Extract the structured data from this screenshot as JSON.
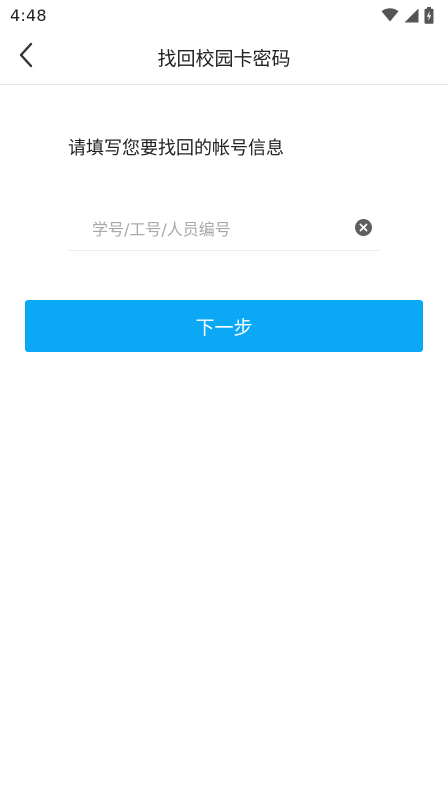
{
  "status_bar": {
    "time": "4:48",
    "icons": [
      "wifi-icon",
      "cellular-signal-icon",
      "battery-charging-icon"
    ]
  },
  "header": {
    "back_icon": "chevron-left-icon",
    "title": "找回校园卡密码"
  },
  "form": {
    "prompt": "请填写您要找回的帐号信息",
    "id_input": {
      "value": "",
      "placeholder": "学号/工号/人员编号"
    },
    "clear_icon": "clear-circle-icon",
    "next_label": "下一步"
  },
  "colors": {
    "primary": "#0aa8f5",
    "text": "#222222",
    "placeholder": "#a8a8a8",
    "divider": "#e6e6e6"
  }
}
